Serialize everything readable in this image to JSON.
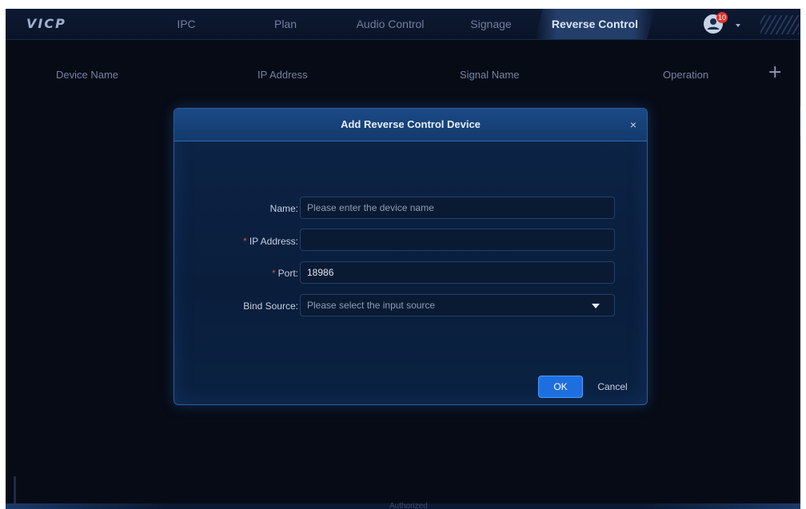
{
  "app": {
    "logo": "VICP"
  },
  "nav": {
    "tabs": [
      {
        "label": "IPC"
      },
      {
        "label": "Plan"
      },
      {
        "label": "Audio Control"
      },
      {
        "label": "Signage"
      },
      {
        "label": "Reverse Control",
        "active": true
      }
    ],
    "notification_count": "10"
  },
  "table": {
    "columns": [
      "Device Name",
      "IP Address",
      "Signal Name",
      "Operation"
    ],
    "add_symbol": "+"
  },
  "modal": {
    "title": "Add Reverse Control Device",
    "close": "×",
    "fields": {
      "name": {
        "label": "Name:",
        "value": "",
        "placeholder": "Please enter the device name",
        "required": false
      },
      "ip": {
        "label": "IP Address:",
        "value": "",
        "placeholder": "",
        "required": true
      },
      "port": {
        "label": "Port:",
        "value": "18986",
        "required": true
      },
      "bind_source": {
        "label": "Bind Source:",
        "value": "",
        "placeholder": "Please select the input source",
        "required": false
      }
    },
    "required_mark": "*",
    "ok_label": "OK",
    "cancel_label": "Cancel"
  },
  "footer": {
    "text": "Authorized"
  },
  "colors": {
    "accent": "#1d6fe0",
    "background": "#070b16",
    "required": "#e0483d"
  }
}
